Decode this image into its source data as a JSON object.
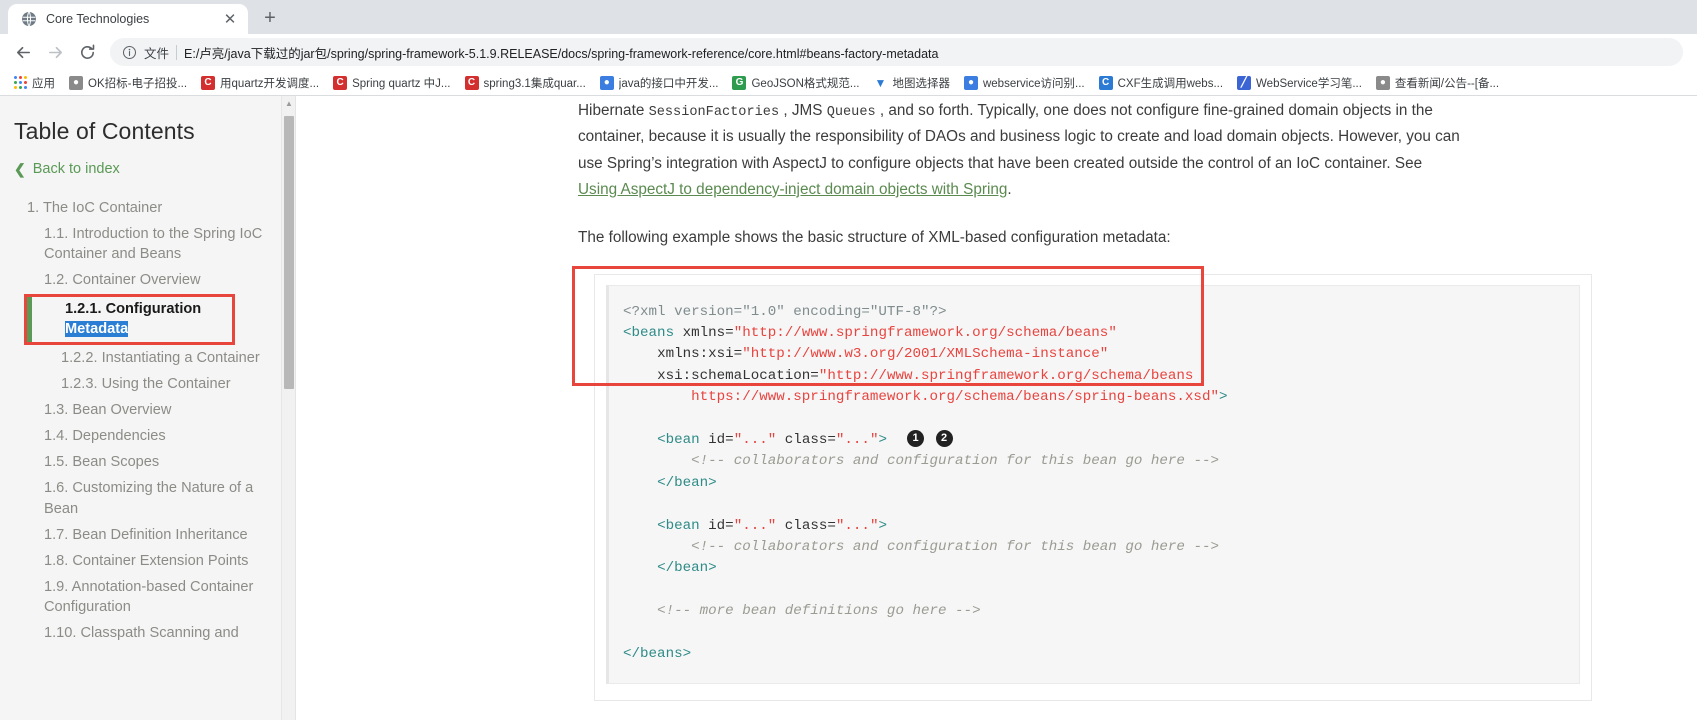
{
  "browser": {
    "tab": {
      "title": "Core Technologies",
      "favicon_icon": "globe-icon",
      "close_icon": "close-icon"
    },
    "new_tab_label": "+",
    "nav": {
      "back_icon": "arrow-left-icon",
      "forward_icon": "arrow-right-icon",
      "reload_icon": "reload-icon"
    },
    "omnibox": {
      "info_icon": "info-circle-icon",
      "scheme_label": "文件",
      "url": "E:/卢亮/java下载过的jar包/spring/spring-framework-5.1.9.RELEASE/docs/spring-framework-reference/core.html#beans-factory-metadata"
    },
    "bookmarks": {
      "apps_label": "应用",
      "apps_icon": "apps-grid-icon",
      "items": [
        {
          "label": "OK招标-电子招投...",
          "icon": "globe-icon",
          "color": "#8a8a8a"
        },
        {
          "label": "用quartz开发调度...",
          "icon": "c-icon",
          "color": "#d32f2f"
        },
        {
          "label": "Spring quartz 中J...",
          "icon": "c-icon",
          "color": "#d32f2f"
        },
        {
          "label": "spring3.1集成quar...",
          "icon": "c-icon",
          "color": "#d32f2f"
        },
        {
          "label": "java的接口中开发...",
          "icon": "baidu-icon",
          "color": "#3b7de0"
        },
        {
          "label": "GeoJSON格式规范...",
          "icon": "g-icon",
          "color": "#2e9b4f"
        },
        {
          "label": "地图选择器",
          "icon": "triangle-icon",
          "color": "#2b7ad4"
        },
        {
          "label": "webservice访问别...",
          "icon": "baidu-icon",
          "color": "#3b7de0"
        },
        {
          "label": "CXF生成调用webs...",
          "icon": "c-square-icon",
          "color": "#2b7ad4"
        },
        {
          "label": "WebService学习笔...",
          "icon": "note-icon",
          "color": "#3b64d4"
        },
        {
          "label": "查看新闻/公告--[备...",
          "icon": "globe-icon",
          "color": "#8a8a8a"
        }
      ]
    }
  },
  "toc": {
    "title": "Table of Contents",
    "back_label": "Back to index",
    "back_icon": "chevron-left-icon",
    "items": [
      {
        "label": "1. The IoC Container",
        "level": 1
      },
      {
        "label": "1.1. Introduction to the Spring IoC Container and Beans",
        "level": 2
      },
      {
        "label": "1.2. Container Overview",
        "level": 2
      },
      {
        "label": "1.2.1. Configuration Metadata",
        "level": 3,
        "current": true
      },
      {
        "label": "1.2.2. Instantiating a Container",
        "level": 3
      },
      {
        "label": "1.2.3. Using the Container",
        "level": 3
      },
      {
        "label": "1.3. Bean Overview",
        "level": 2
      },
      {
        "label": "1.4. Dependencies",
        "level": 2
      },
      {
        "label": "1.5. Bean Scopes",
        "level": 2
      },
      {
        "label": "1.6. Customizing the Nature of a Bean",
        "level": 2
      },
      {
        "label": "1.7. Bean Definition Inheritance",
        "level": 2
      },
      {
        "label": "1.8. Container Extension Points",
        "level": 2
      },
      {
        "label": "1.9. Annotation-based Container Configuration",
        "level": 2
      },
      {
        "label": "1.10. Classpath Scanning and",
        "level": 2
      }
    ],
    "current_item": {
      "plain_prefix": "1.2.1. Configuration ",
      "highlighted": "Metadata"
    }
  },
  "article": {
    "paragraph1": {
      "seg1": "Hibernate ",
      "code1": "SessionFactories",
      "seg2": " , JMS ",
      "code2": "Queues",
      "seg3": " , and so forth. Typically, one does not configure fine-grained domain objects in the container, because it is usually the responsibility of DAOs and business logic to create and load domain objects. However, you can use Spring’s integration with AspectJ to configure objects that have been created outside the control of an IoC container. See ",
      "link": "Using AspectJ to dependency-inject domain objects with Spring",
      "seg4": "."
    },
    "paragraph2": "The following example shows the basic structure of XML-based configuration metadata:",
    "code": {
      "language": "xml",
      "lines": [
        "<?xml version=\"1.0\" encoding=\"UTF-8\"?>",
        "<beans xmlns=\"http://www.springframework.org/schema/beans\"",
        "    xmlns:xsi=\"http://www.w3.org/2001/XMLSchema-instance\"",
        "    xsi:schemaLocation=\"http://www.springframework.org/schema/beans",
        "        https://www.springframework.org/schema/beans/spring-beans.xsd\">",
        "",
        "    <bean id=\"...\" class=\"...\">  (1) (2)",
        "        <!-- collaborators and configuration for this bean go here -->",
        "    </bean>",
        "",
        "    <bean id=\"...\" class=\"...\">",
        "        <!-- collaborators and configuration for this bean go here -->",
        "    </bean>",
        "",
        "    <!-- more bean definitions go here -->",
        "",
        "</beans>"
      ],
      "callouts": [
        "1",
        "2"
      ]
    }
  },
  "annotations": {
    "highlight_color": "#e8453c",
    "selection_color": "#2a7fd4",
    "link_color": "#5a8a4f"
  }
}
